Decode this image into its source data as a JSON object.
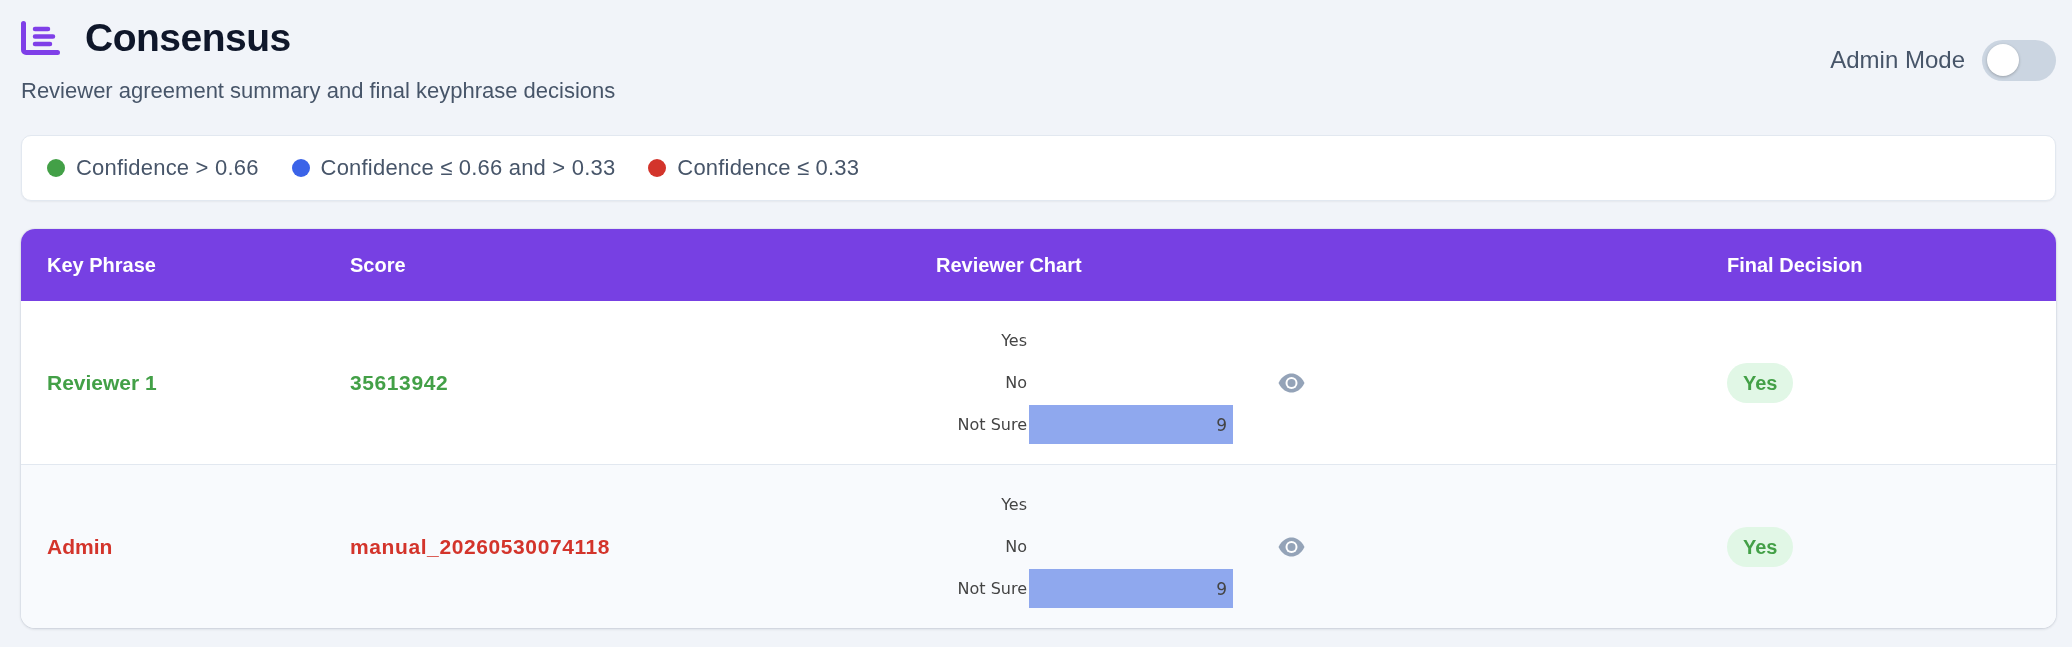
{
  "header": {
    "title": "Consensus",
    "subtitle": "Reviewer agreement summary and final keyphrase decisions"
  },
  "admin_mode": {
    "label": "Admin Mode",
    "on": false
  },
  "legend": [
    {
      "label": "Confidence > 0.66",
      "color": "#43a047"
    },
    {
      "label": "Confidence ≤ 0.66 and > 0.33",
      "color": "#3b63e8"
    },
    {
      "label": "Confidence ≤ 0.33",
      "color": "#d3342b"
    }
  ],
  "table": {
    "columns": [
      "Key Phrase",
      "Score",
      "Reviewer Chart",
      "Final Decision"
    ],
    "rows": [
      {
        "key_phrase": "Reviewer 1",
        "score": "35613942",
        "color": "#43a047",
        "chart_data": {
          "type": "bar",
          "orientation": "horizontal",
          "categories": [
            "Yes",
            "No",
            "Not Sure"
          ],
          "values": [
            null,
            null,
            9
          ],
          "data_labels": true
        },
        "final_decision": "Yes"
      },
      {
        "key_phrase": "Admin",
        "score": "manual_20260530074118",
        "color": "#d3342b",
        "chart_data": {
          "type": "bar",
          "orientation": "horizontal",
          "categories": [
            "Yes",
            "No",
            "Not Sure"
          ],
          "values": [
            null,
            null,
            9
          ],
          "data_labels": true
        },
        "final_decision": "Yes"
      }
    ]
  }
}
